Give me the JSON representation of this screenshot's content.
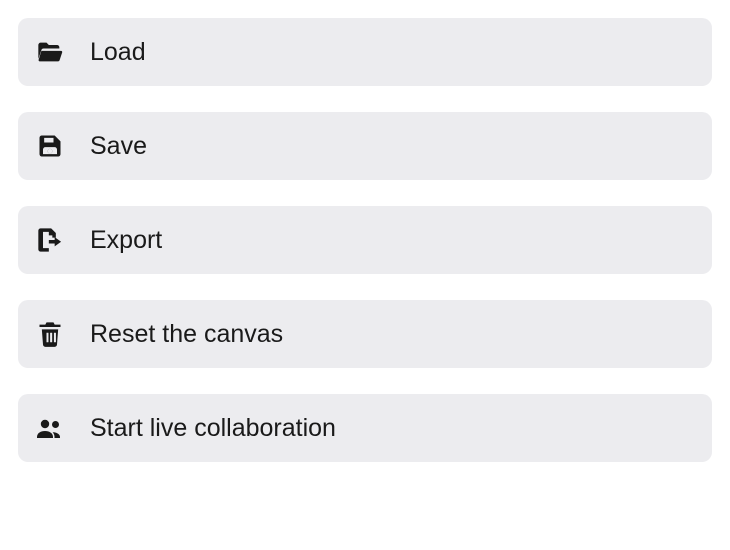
{
  "menu": {
    "items": [
      {
        "label": "Load"
      },
      {
        "label": "Save"
      },
      {
        "label": "Export"
      },
      {
        "label": "Reset the canvas"
      },
      {
        "label": "Start live collaboration"
      }
    ]
  }
}
